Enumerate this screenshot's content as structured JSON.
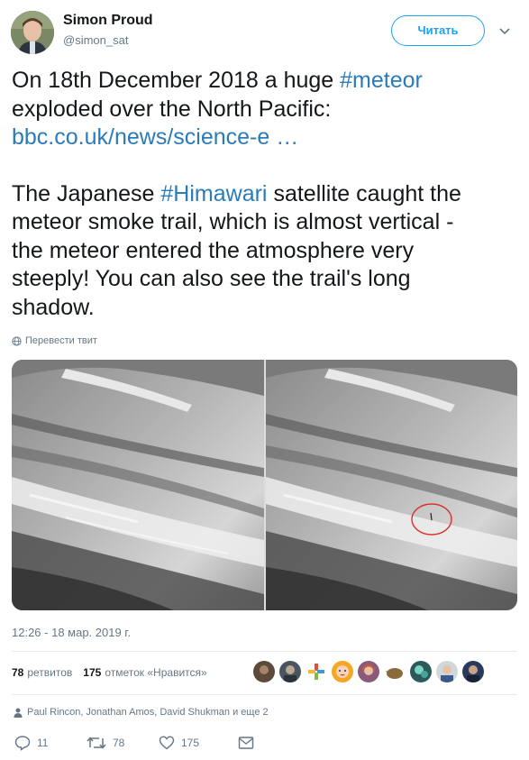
{
  "author": {
    "name": "Simon Proud",
    "handle": "@simon_sat",
    "follow_label": "Читать"
  },
  "tweet": {
    "line1_prefix": "On 18th December 2018 a huge ",
    "hashtag1": "#meteor",
    "line2": "exploded over the North Pacific:",
    "link": "bbc.co.uk/news/science-e …",
    "para2_prefix": "The Japanese ",
    "hashtag2": "#Himawari",
    "para2_rest_line1": " satellite caught the",
    "para2_line2": "meteor smoke trail, which is almost vertical -",
    "para2_line3": "the meteor entered the atmosphere very",
    "para2_line4": "steeply! You can also see the trail's long",
    "para2_line5": "shadow."
  },
  "translate_label": "Перевести твит",
  "timestamp": "12:26 - 18 мар. 2019 г.",
  "stats": {
    "retweets_count": "78",
    "retweets_label": "ретвитов",
    "likes_count": "175",
    "likes_label": "отметок «Нравится»"
  },
  "replying_to": "Paul Rincon, Jonathan Amos, David Shukman и еще 2",
  "actions": {
    "reply_count": "11",
    "retweet_count": "78",
    "like_count": "175"
  },
  "icons": {
    "globe": "globe-icon",
    "chevron": "chevron-down-icon",
    "reply": "reply-icon",
    "retweet": "retweet-icon",
    "like": "heart-icon",
    "dm": "envelope-icon",
    "person": "person-icon"
  },
  "colors": {
    "link": "#2b7bb9",
    "accent": "#1da1f2",
    "muted": "#657786",
    "annotation_circle": "#d9302c"
  }
}
